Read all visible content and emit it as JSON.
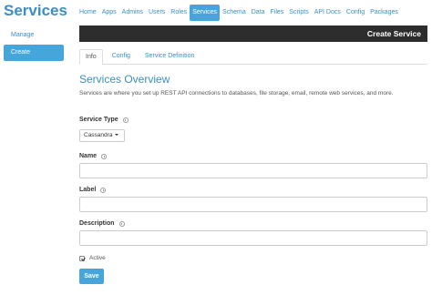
{
  "app": {
    "title": "Services"
  },
  "sidebar": {
    "items": [
      {
        "label": "Manage"
      },
      {
        "label": "Create"
      }
    ]
  },
  "top_nav": {
    "items": [
      {
        "label": "Home"
      },
      {
        "label": "Apps"
      },
      {
        "label": "Admins"
      },
      {
        "label": "Users"
      },
      {
        "label": "Roles"
      },
      {
        "label": "Services"
      },
      {
        "label": "Schema"
      },
      {
        "label": "Data"
      },
      {
        "label": "Files"
      },
      {
        "label": "Scripts"
      },
      {
        "label": "API Docs"
      },
      {
        "label": "Config"
      },
      {
        "label": "Packages"
      }
    ],
    "active": "Services"
  },
  "header": {
    "title": "Create Service"
  },
  "tabs": [
    {
      "label": "Info"
    },
    {
      "label": "Config"
    },
    {
      "label": "Service Definition"
    }
  ],
  "overview": {
    "title": "Services Overview",
    "description": "Services are where you set up REST API connections to databases, file storage, email, remote web services, and more."
  },
  "form": {
    "service_type": {
      "label": "Service Type",
      "value": "Cassandra"
    },
    "name": {
      "label": "Name",
      "value": ""
    },
    "label": {
      "label": "Label",
      "value": ""
    },
    "description": {
      "label": "Description",
      "value": ""
    },
    "active": {
      "label": "Active",
      "checked": true
    },
    "save_label": "Save"
  },
  "colors": {
    "accent": "#46a6dc",
    "header_bg": "#2d2d2d"
  },
  "icons": {
    "info": "info-icon",
    "caret": "caret-down-icon",
    "check": "checkbox-icon"
  }
}
